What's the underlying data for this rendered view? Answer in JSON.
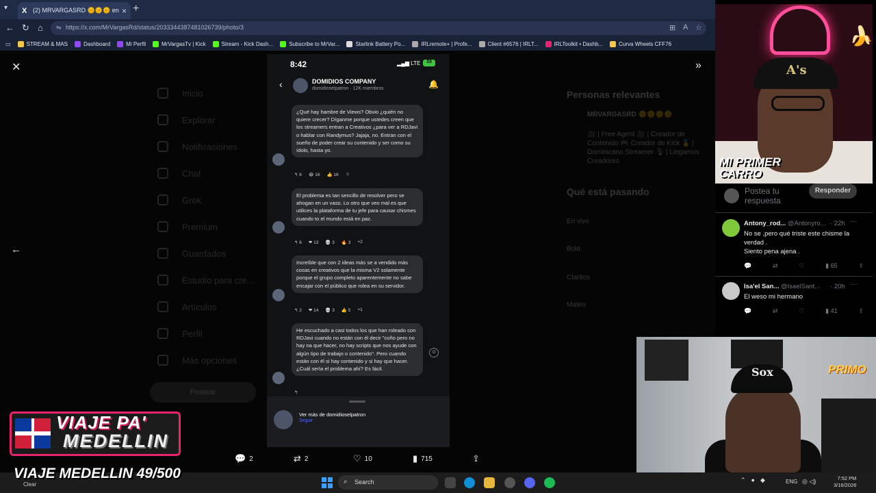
{
  "browser": {
    "tab_title": "(2) MRVARGASRD 🌞🌞🌞 en",
    "tab_icon": "X",
    "url": "https://x.com/MrVargasRd/status/2033344387481026739/photo/3",
    "bookmarks": [
      {
        "label": "STREAM & MAS",
        "color": "#f2c84b"
      },
      {
        "label": "Dashboard",
        "color": "#9146ff"
      },
      {
        "label": "Mi Perfil",
        "color": "#9146ff"
      },
      {
        "label": "MrVargasTv | Kick",
        "color": "#53fc18"
      },
      {
        "label": "Stream - Kick Dash...",
        "color": "#53fc18"
      },
      {
        "label": "Subscribe to MrVar...",
        "color": "#53fc18"
      },
      {
        "label": "Starlink Battery Po...",
        "color": "#dddddd"
      },
      {
        "label": "IRLremote+ | Profe...",
        "color": "#aaaaaa"
      },
      {
        "label": "Client #6576 | IRLT...",
        "color": "#aaaaaa"
      },
      {
        "label": "IRLToolkit • Dashb...",
        "color": "#e8246f"
      },
      {
        "label": "Curva Wheels CFF76",
        "color": "#f2c84b"
      }
    ]
  },
  "xpage": {
    "sidebar": [
      "Inicio",
      "Explorar",
      "Notificaciones",
      "Chat",
      "Grok",
      "Premium",
      "Guardados",
      "Estudio para cre...",
      "Artículos",
      "Perfil",
      "Más opciones"
    ],
    "post_button": "Postear",
    "right": {
      "relevant_title": "Personas relevantes",
      "relevant_name": "MRVARGASRD 🌞🌞🌞🌞",
      "relevant_bio": "🎥 | Free Agent 🎥 | Creador de Contenido 🎮 Creador de Kick 🥇 | Dominicano Streamer 🎙 | Llegamos Creadores",
      "trending_title": "Qué está pasando",
      "trends": [
        "En vivo",
        "Bola",
        "Claritos",
        "Mateo"
      ]
    }
  },
  "phone": {
    "time": "8:42",
    "network": "LTE",
    "battery": "33",
    "channel_name": "DOMIDIOS COMPANY",
    "channel_sub": "domidioselpatron · 12K miembros",
    "messages": [
      {
        "text": "¿Qué hay hambre de Views? Obvio ¿quién no quiere crecer? Díganme porque ustedes creen que los streamers entran a Creativos ¿para ver a RDJavi o hablar con Randymus? Jajaja, no. Entran con el sueño de poder crear su contenido y ser como su ídolo, hasta yo.",
        "reactions": [
          "↰ 6",
          "😂 16",
          "👍 16",
          "☺"
        ]
      },
      {
        "text": "El problema es tan sencillo de resolver pero se ahogan en un vaso. Lo otro que veo mal es que utilices la plataforma de tu jefe para causar chismes cuando to el mundo está en paz.",
        "reactions": [
          "↰ 6",
          "❤ 13",
          "💀 3",
          "🔥 3",
          "+2"
        ]
      },
      {
        "text": "Increíble que con 2 ideas más se a vendido más cosas en creativos que la misma V2 solamente porque el grupo completo aparentemente no sabe encajar con el público que rolea en su servidor.",
        "reactions": [
          "↰ 2",
          "❤ 14",
          "💀 3",
          "👍 5",
          "+1"
        ]
      },
      {
        "text": "He escuchado a casi todos los que han roleado con RDJavi cuando no están con él decir \"coño pero no hay na que hacer, no hay scripts que nos ayude con algún tipo de trabajo o contenido\". Pero cuando están con él si hay contenido y si hay que hacer. ¿Cuál sería el problema ahí? Es fácil.",
        "reactions": [
          "↰"
        ]
      }
    ],
    "see_more": "Ver más de domidioselpatron",
    "follow": "Seguir"
  },
  "post_actions": {
    "replies": "2",
    "reposts": "2",
    "likes": "10",
    "views": "715"
  },
  "replies_panel": {
    "compose_placeholder": "Postea tu respuesta",
    "reply_button": "Responder",
    "replies": [
      {
        "name": "Antony_rod...",
        "handle": "@Antonyro...",
        "time": "· 22h",
        "text": "No se ,pero qué triste este chisme la verdad .\nSiento pena ajena .",
        "views": "65",
        "avatar_color": "#7ec83a"
      },
      {
        "name": "Isa'el San...",
        "handle": "@IsaelSant...",
        "time": "· 20h",
        "text": "El weso mi hermano",
        "views": "41",
        "avatar_color": "#c9c9c9"
      }
    ]
  },
  "overlays": {
    "cam1_banner": "MI PRIMER CARRO",
    "cam2_banner": "PRIMO",
    "viaje_line1": "VIAJE PA'",
    "viaje_line2": "MEDELLIN",
    "counter": "VIAJE MEDELLIN 49/500"
  },
  "taskbar": {
    "weather": "Clear",
    "search": "Search",
    "lang": "ENG",
    "time": "7:52 PM",
    "date": "3/16/2026"
  }
}
